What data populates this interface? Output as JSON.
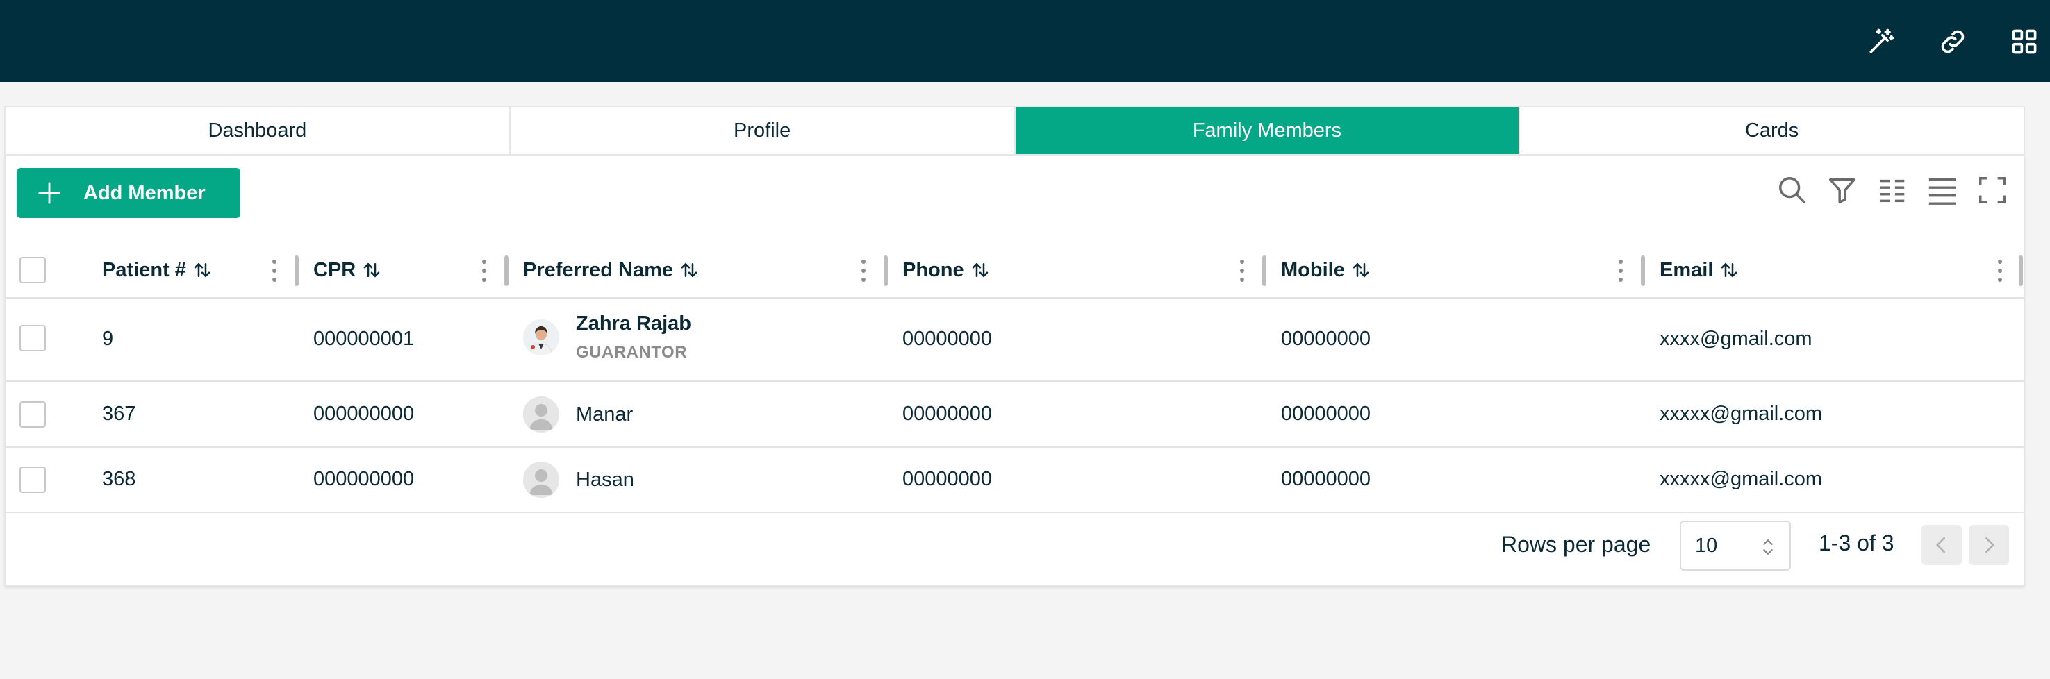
{
  "header": {
    "icons": [
      "magic-wand-icon",
      "link-icon",
      "apps-grid-icon"
    ],
    "background": "#022f3d"
  },
  "tabs": [
    {
      "label": "Dashboard",
      "active": false
    },
    {
      "label": "Profile",
      "active": false
    },
    {
      "label": "Family Members",
      "active": true
    },
    {
      "label": "Cards",
      "active": false
    }
  ],
  "toolbar": {
    "add_label": "Add Member",
    "tools": [
      "search-icon",
      "filter-icon",
      "columns-icon",
      "density-icon",
      "fullscreen-icon"
    ]
  },
  "table": {
    "columns": [
      "Patient #",
      "CPR",
      "Preferred Name",
      "Phone",
      "Mobile",
      "Email"
    ],
    "rows": [
      {
        "patient": "9",
        "cpr": "000000001",
        "name": "Zahra Rajab",
        "role": "GUARANTOR",
        "phone": "00000000",
        "mobile": "00000000",
        "email": "xxxx@gmail.com",
        "avatar": "photo"
      },
      {
        "patient": "367",
        "cpr": "000000000",
        "name": "Manar",
        "role": "",
        "phone": "00000000",
        "mobile": "00000000",
        "email": "xxxxx@gmail.com",
        "avatar": "placeholder"
      },
      {
        "patient": "368",
        "cpr": "000000000",
        "name": "Hasan",
        "role": "",
        "phone": "00000000",
        "mobile": "00000000",
        "email": "xxxxx@gmail.com",
        "avatar": "placeholder"
      }
    ]
  },
  "pagination": {
    "rows_per_page_label": "Rows per page",
    "rows_per_page_value": "10",
    "range": "1-3 of 3"
  },
  "colors": {
    "accent": "#04a886",
    "header": "#022f3d",
    "text": "#0c2a35"
  }
}
